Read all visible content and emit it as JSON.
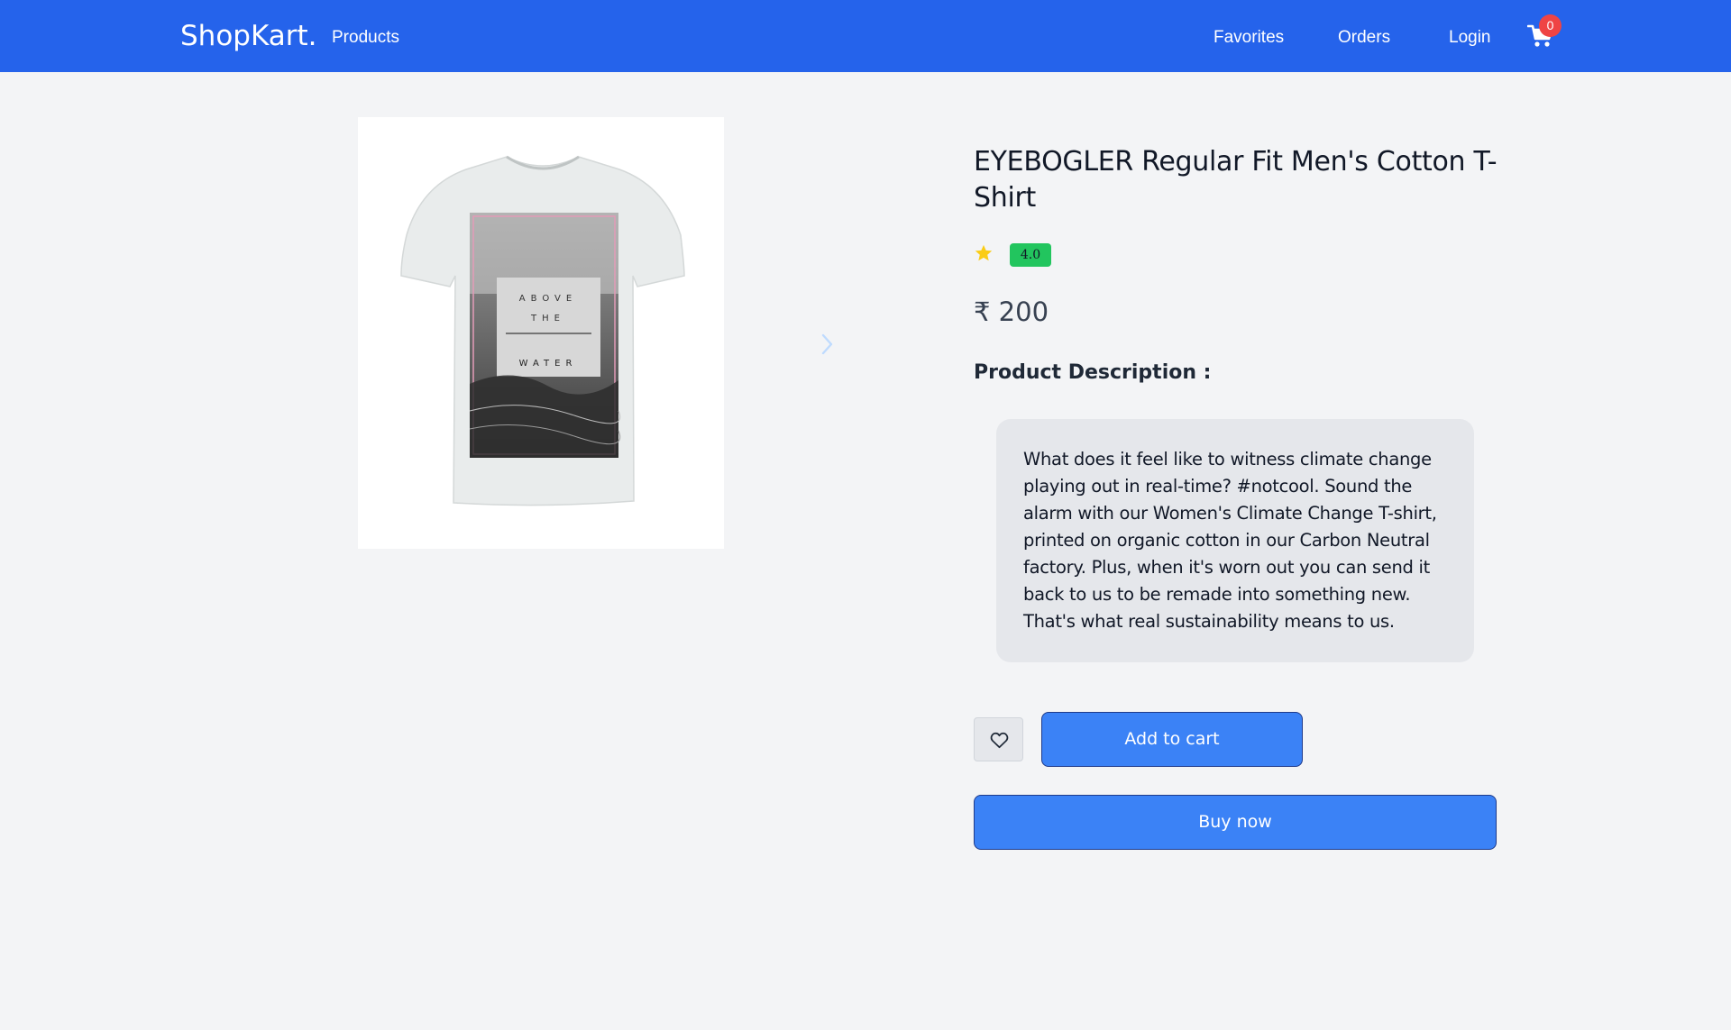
{
  "navbar": {
    "brand": "ShopKart.",
    "products_label": "Products",
    "favorites_label": "Favorites",
    "orders_label": "Orders",
    "login_label": "Login",
    "cart_count": "0",
    "cart_icon": "shopping-cart-icon",
    "background_color": "#2563eb",
    "badge_color": "#ef4444"
  },
  "product": {
    "image_icon": "product-tshirt-image",
    "next_icon": "chevron-right-icon",
    "title": "EYEBOGLER Regular Fit Men's Cotton T-Shirt",
    "rating": "4.0",
    "rating_icon": "star-icon",
    "rating_badge_color": "#22c55e",
    "price": "₹ 200",
    "description_heading": "Product Description :",
    "description": "What does it feel like to witness climate change playing out in real-time? #notcool. Sound the alarm with our Women's Climate Change T-shirt, printed on organic cotton in our Carbon Neutral factory. Plus, when it's worn out you can send it back to us to be remade into something new. That's what real sustainability means to us."
  },
  "actions": {
    "favorite_icon": "heart-icon",
    "add_to_cart_label": "Add to cart",
    "buy_now_label": "Buy now",
    "button_color": "#3b82f6"
  }
}
